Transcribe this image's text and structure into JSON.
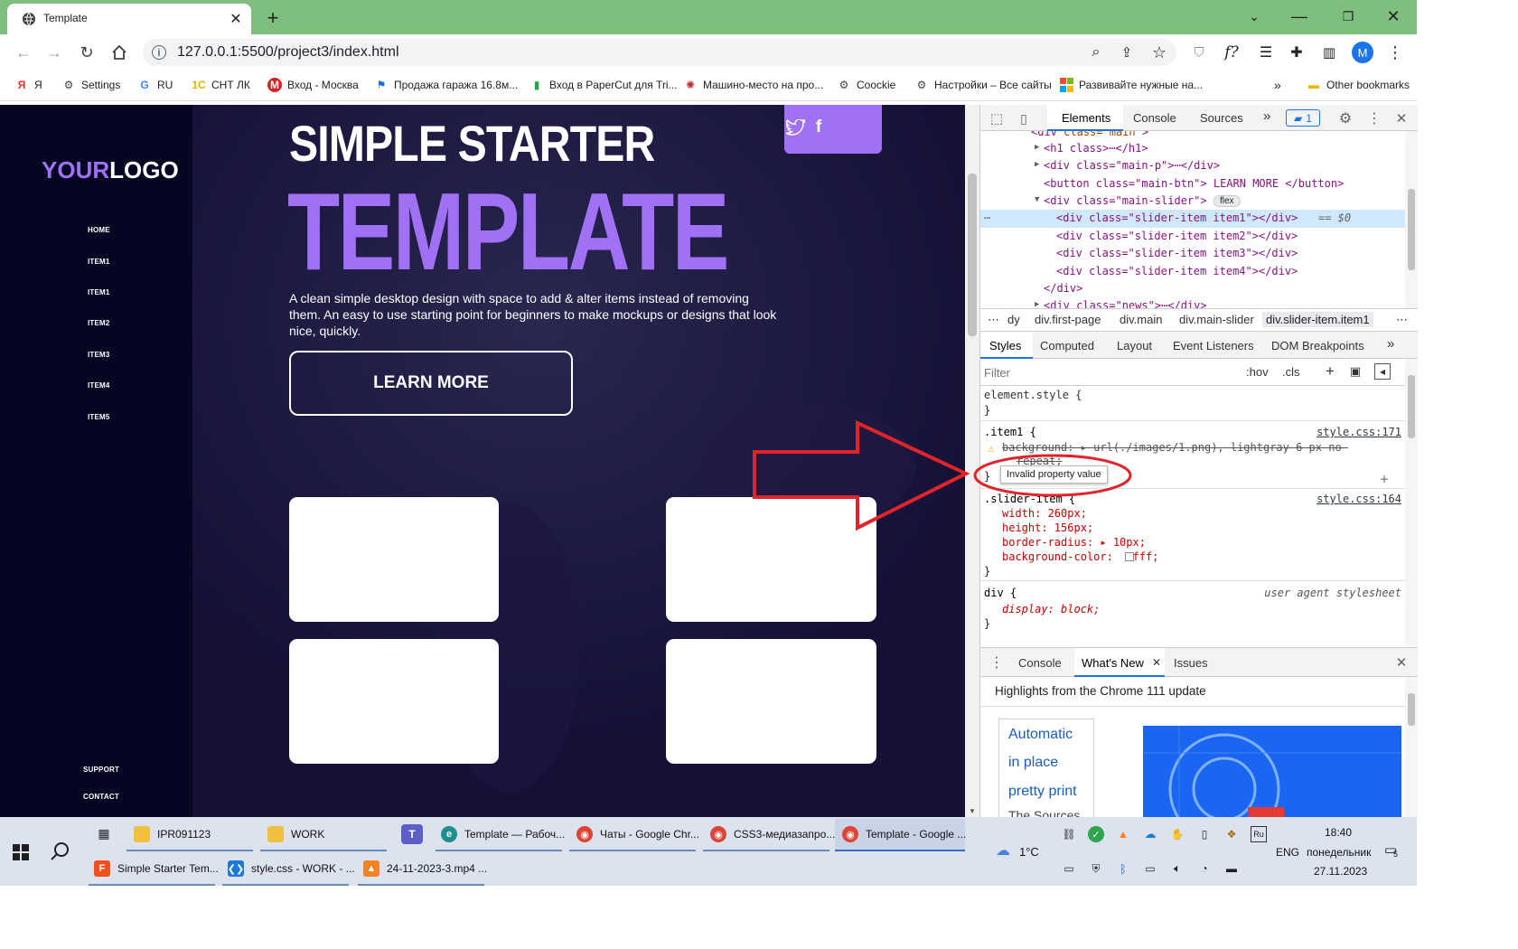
{
  "browser": {
    "tab_title": "Template",
    "url": "127.0.0.1:5500/project3/index.html",
    "bookmarks": [
      {
        "label": "Я",
        "icon": "yandex-icon",
        "color": "#e3302b"
      },
      {
        "label": "Settings",
        "icon": "gear-icon",
        "color": "#444"
      },
      {
        "label": "RU",
        "icon": "google-icon",
        "color": "#4285f4"
      },
      {
        "label": "СНТ ЛК",
        "icon": "1c-icon",
        "color": "#f5c400"
      },
      {
        "label": "Вход - Москва",
        "icon": "m-icon",
        "color": "#d32222"
      },
      {
        "label": "Продажа гаража 16.8м...",
        "icon": "flag-icon",
        "color": "#1a6cdc"
      },
      {
        "label": "Вход в PaperCut для Tri...",
        "icon": "chat-icon",
        "color": "#2aa34a"
      },
      {
        "label": "Машино-место на про...",
        "icon": "badge-icon",
        "color": "#c62828"
      },
      {
        "label": "Coockie",
        "icon": "gear-icon",
        "color": "#444"
      },
      {
        "label": "Настройки – Все сайты",
        "icon": "gear-icon",
        "color": "#444"
      },
      {
        "label": "Развивайте нужные на...",
        "icon": "ms-icon",
        "color": "#f25022"
      }
    ],
    "other_bookmarks": "Other bookmarks",
    "more_bookmarks": "»",
    "avatar_letter": "M"
  },
  "page": {
    "logo_your": "YOUR",
    "logo_logo": "LOGO",
    "logo_accent": "#a071f5",
    "nav": [
      "HOME",
      "ITEM1",
      "ITEM1",
      "ITEM2",
      "ITEM3",
      "ITEM4",
      "ITEM5"
    ],
    "footer_nav": [
      "SUPPORT",
      "CONTACT"
    ],
    "hero_title_1": "SIMPLE STARTER",
    "hero_title_2": "TEMPLATE",
    "hero_text": "A clean simple desktop design with space to add & alter items instead of removing them. An easy to use starting point for beginners to make mockups or designs that look nice, quickly.",
    "cta_label": "LEARN MORE"
  },
  "devtools": {
    "tabs": [
      "Elements",
      "Console",
      "Sources"
    ],
    "more_tabs": "»",
    "issues_count": "1",
    "dom_lines": [
      {
        "open": "<",
        "tag": "div",
        "attrs": " class=\"main\"",
        "close": ">"
      },
      {
        "text": "<h1 class>⋯</h1>"
      },
      {
        "text": "<div class=\"main-p\">⋯</div>"
      },
      {
        "text": "<button class=\"main-btn\"> LEARN MORE </button>"
      },
      {
        "text": "<div class=\"main-slider\">"
      },
      {
        "text": "<div class=\"slider-item item1\"></div>"
      },
      {
        "text": "<div class=\"slider-item item2\"></div>"
      },
      {
        "text": "<div class=\"slider-item item3\"></div>"
      },
      {
        "text": "<div class=\"slider-item item4\"></div>"
      },
      {
        "text": "</div>"
      },
      {
        "text": "<div class=\"news\">⋯</div>"
      }
    ],
    "flex_badge": "flex",
    "selected_suffix": "== $0",
    "breadcrumbs": [
      "dy",
      "div.first-page",
      "div.main",
      "div.main-slider",
      "div.slider-item.item1"
    ],
    "style_tabs": [
      "Styles",
      "Computed",
      "Layout",
      "Event Listeners",
      "DOM Breakpoints"
    ],
    "filter_placeholder": "Filter",
    "hov": ":hov",
    "cls": ".cls",
    "rules": {
      "element_style": "element.style {",
      "close": "}",
      "item1_selector": ".item1 {",
      "item1_source": "style.css:171",
      "item1_decl": "background: ▸ url(./images/1.png), lightgray 6 px no-",
      "item1_decl_cont": "repeat;",
      "tooltip": "Invalid property value",
      "slider_selector": ".slider-item {",
      "slider_source": "style.css:164",
      "width": "width: 260px;",
      "height": "height: 156px;",
      "radius": "border-radius: ▸ 10px;",
      "bg": "background-color:  #fff;",
      "div_selector": "div {",
      "ua": "user agent stylesheet",
      "display": "display: block;"
    },
    "drawer_tabs": [
      "Console",
      "What's New",
      "Issues"
    ],
    "highlights": "Highlights from the Chrome 111 update",
    "whatsnew_items": [
      "Automatic",
      "in place",
      "pretty print",
      "The Sources"
    ]
  },
  "taskbar": {
    "top_row": [
      "IPR091123",
      "WORK",
      "Template — Рабоч...",
      "Чаты - Google Chr...",
      "CSS3-медиазапро...",
      "Template - Google ..."
    ],
    "bottom_row": [
      "Simple Starter Tem...",
      "style.css - WORK - ...",
      "24-11-2023-3.mp4 ..."
    ],
    "weather": "1°C",
    "lang": "ENG",
    "time": "18:40",
    "day": "понедельник",
    "date": "27.11.2023",
    "notif_count": "5"
  }
}
